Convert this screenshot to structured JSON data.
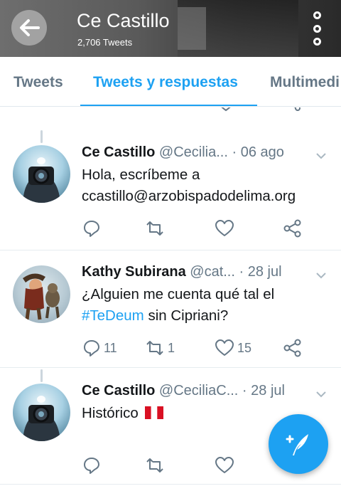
{
  "header": {
    "title": "Ce Castillo",
    "subtitle": "2,706 Tweets"
  },
  "tabs": [
    {
      "label": "Tweets"
    },
    {
      "label": "Tweets y respuestas"
    },
    {
      "label": "Multimedi"
    }
  ],
  "tweets": [
    {
      "name": "Ce Castillo",
      "handle": "@Cecilia...",
      "date": "· 06 ago",
      "text_line1": "Hola, escríbeme a",
      "text_line2": "ccastillo@arzobispadodelima.org"
    },
    {
      "name": "Kathy Subirana",
      "handle": "@cat...",
      "date": "· 28 jul",
      "text_line1": "¿Alguien me cuenta qué tal el",
      "hashtag": "#TeDeum",
      "text_line2_rest": " sin Cipriani?",
      "replies": "11",
      "retweets": "1",
      "likes": "15"
    },
    {
      "name": "Ce Castillo",
      "handle": "@CeciliaC...",
      "date": "· 28 jul",
      "text": "Histórico",
      "flag": "Peru flag"
    }
  ],
  "icons": {
    "back": "back-arrow-icon",
    "more": "more-vertical-icon",
    "reply": "reply-icon",
    "retweet": "retweet-icon",
    "like": "heart-icon",
    "share": "share-icon",
    "compose": "compose-quill-icon"
  },
  "colors": {
    "accent": "#1da1f2",
    "muted": "#657786",
    "flag_red": "#d91023"
  }
}
